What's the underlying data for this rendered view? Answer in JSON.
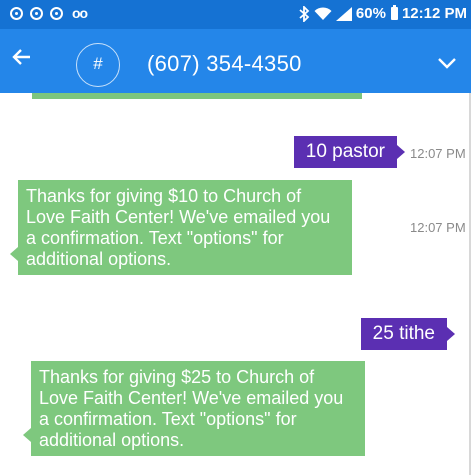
{
  "status_bar": {
    "voicemail_glyph": "oo",
    "battery": "60%",
    "time": "12:12 PM",
    "icons": [
      "chrome-icon",
      "chrome-icon",
      "chrome-icon",
      "voicemail-icon",
      "bluetooth-icon",
      "wifi-icon",
      "signal-icon",
      "battery-icon"
    ]
  },
  "app_bar": {
    "avatar_symbol": "#",
    "title": "(607) 354-4350",
    "back_glyph": "←",
    "colors": {
      "status_bar": "#1572d3",
      "app_bar": "#2486e9"
    }
  },
  "messages": [
    {
      "direction": "outgoing",
      "text": "10 pastor",
      "time": "12:07 PM"
    },
    {
      "direction": "incoming",
      "text": "Thanks for giving $10 to Church of Love Faith Center! We've emailed you a confirmation. Text \"options\" for additional options.",
      "time": "12:07 PM"
    },
    {
      "direction": "outgoing",
      "text": "25 tithe"
    },
    {
      "direction": "incoming",
      "text": "Thanks for giving $25 to Church of Love Faith Center! We've emailed you a confirmation. Text \"options\" for additional options."
    }
  ],
  "colors": {
    "outgoing_bubble": "#5b2fb2",
    "incoming_bubble": "#7ec87e"
  }
}
